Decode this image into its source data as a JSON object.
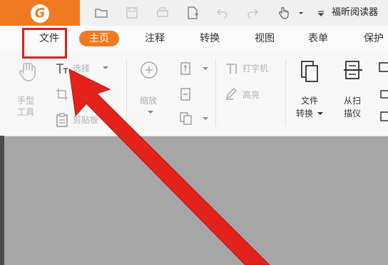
{
  "app": {
    "title": "福昕阅读器",
    "logo_letter": "G",
    "accent": "#f07a22"
  },
  "toolbar_icons": [
    "folder-open-icon",
    "save-icon",
    "print-icon",
    "new-file-icon",
    "undo-icon",
    "redo-icon",
    "paint-icon",
    "hand-cursor-icon",
    "dropdown-icon",
    "customize-icon"
  ],
  "tabs": [
    {
      "id": "file",
      "label": "文件"
    },
    {
      "id": "home",
      "label": "主页",
      "active": true
    },
    {
      "id": "comment",
      "label": "注释"
    },
    {
      "id": "convert",
      "label": "转换"
    },
    {
      "id": "view",
      "label": "视图"
    },
    {
      "id": "form",
      "label": "表单"
    },
    {
      "id": "protect",
      "label": "保护"
    }
  ],
  "ribbon": {
    "hand": "手型工具",
    "select": "选择",
    "snapshot": "截图",
    "clipboard": "剪贴板",
    "zoom": "缩放",
    "typewriter": "打字机",
    "highlight": "高亮",
    "file_convert_1": "文件",
    "file_convert_2": "转换",
    "scan_1": "从扫",
    "scan_2": "描仪"
  },
  "colors": {
    "highlight_box": "#e0211c",
    "arrow": "#e0211c",
    "canvas": "#a6a6a6"
  }
}
